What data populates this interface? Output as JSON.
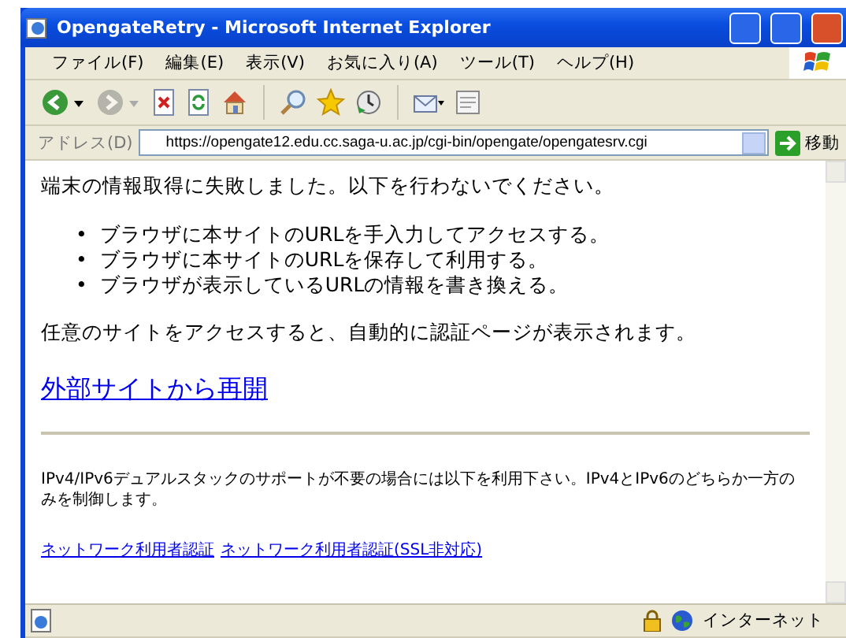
{
  "window": {
    "title": "OpengateRetry - Microsoft Internet Explorer"
  },
  "menu": [
    "ファイル(F)",
    "編集(E)",
    "表示(V)",
    "お気に入り(A)",
    "ツール(T)",
    "ヘルプ(H)"
  ],
  "toolbar": [
    [
      {
        "kind": "back",
        "disabled": false
      },
      {
        "kind": "forward",
        "disabled": true
      },
      {
        "kind": "stop",
        "disabled": false
      },
      {
        "kind": "refresh",
        "disabled": false
      },
      {
        "kind": "home",
        "disabled": false
      }
    ],
    [
      {
        "kind": "search",
        "disabled": false
      },
      {
        "kind": "favorites",
        "disabled": false
      },
      {
        "kind": "history",
        "disabled": false
      }
    ],
    [
      {
        "kind": "mail",
        "disabled": false
      },
      {
        "kind": "print",
        "disabled": false
      }
    ]
  ],
  "address": {
    "label": "アドレス(D)",
    "value": "https://opengate12.edu.cc.saga-u.ac.jp/cgi-bin/opengate/opengatesrv.cgi",
    "go": "移動"
  },
  "content": {
    "intro": "端末の情報取得に失敗しました。以下を行わないでください。",
    "items": [
      {
        "marker": "•",
        "text": "ブラウザに本サイトのURLを手入力してアクセスする。"
      },
      {
        "marker": "•",
        "text": "ブラウザに本サイトのURLを保存して利用する。"
      },
      {
        "marker": "•",
        "text": "ブラウザが表示しているURLの情報を書き換える。"
      }
    ],
    "notice": "任意のサイトをアクセスすると、自動的に認証ページが表示されます。",
    "retry_link": "外部サイトから再開",
    "note": "IPv4/IPv6デュアルスタックのサポートが不要の場合には以下を利用下さい。IPv4とIPv6のどちらか一方のみを制御します。",
    "links": [
      "ネットワーク利用者認証",
      "ネットワーク利用者認証(SSL非対応)"
    ]
  },
  "status_bar": {
    "zone": "インターネット"
  }
}
